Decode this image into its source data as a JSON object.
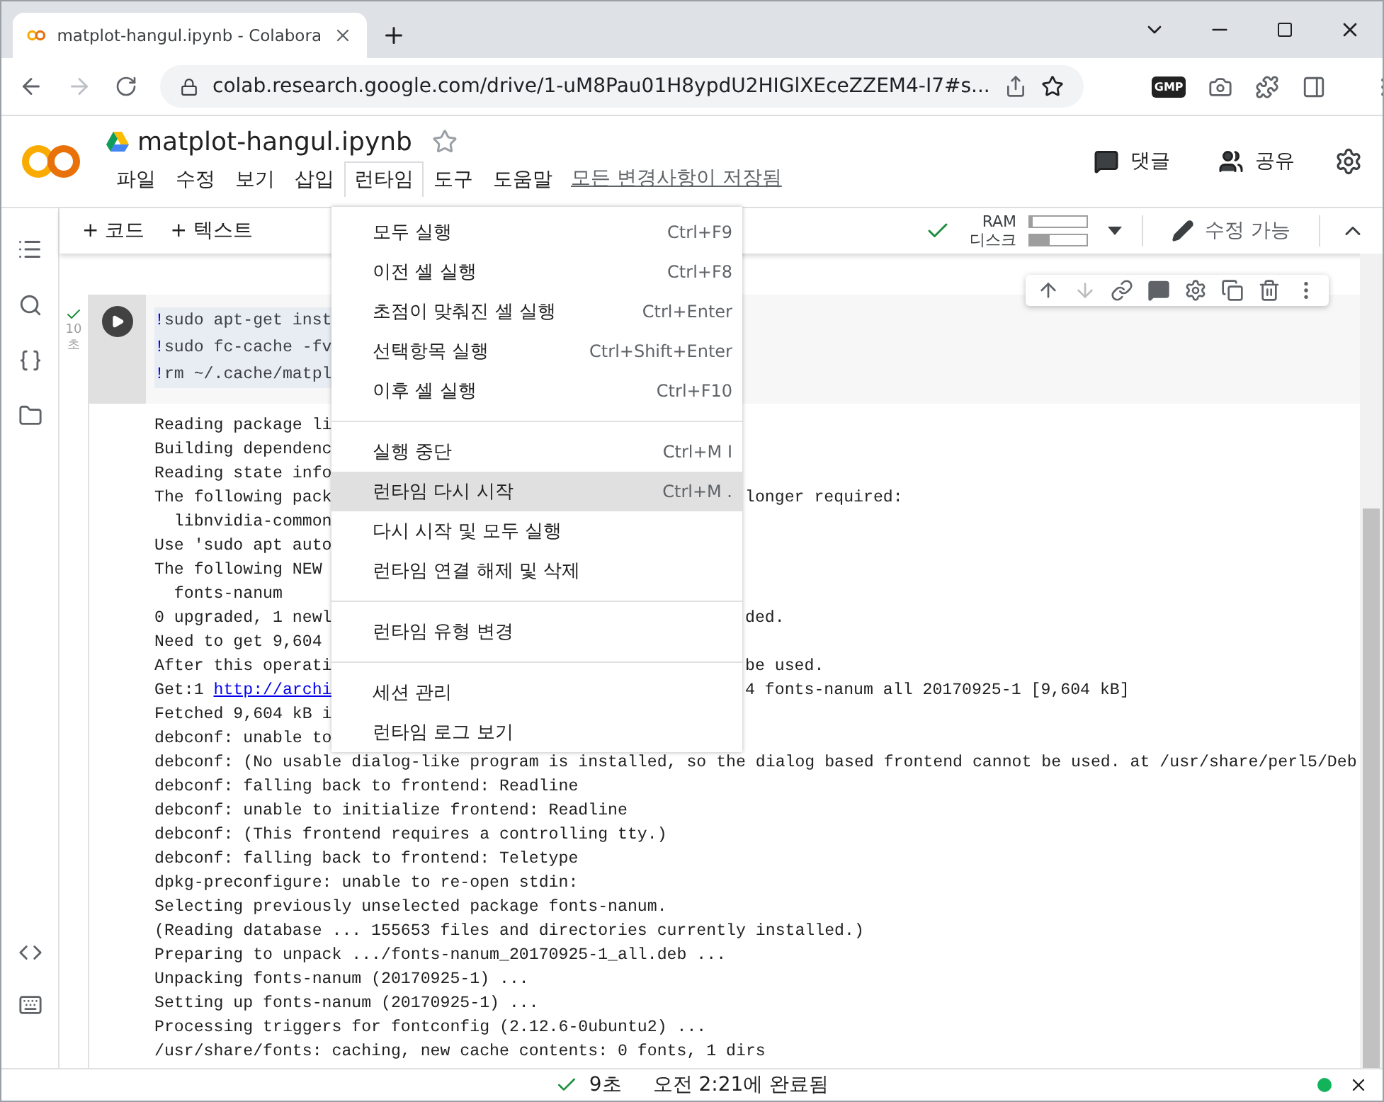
{
  "browser": {
    "tab_title": "matplot-hangul.ipynb - Colabora",
    "url": "colab.research.google.com/drive/1-uM8Pau01H8ypdU2HIGlXEceZZEM4-I7#s...",
    "extension_label": "GMP"
  },
  "notebook": {
    "title": "matplot-hangul.ipynb",
    "starred": false,
    "menu": [
      {
        "label": "파일",
        "selected": false
      },
      {
        "label": "수정",
        "selected": false
      },
      {
        "label": "보기",
        "selected": false
      },
      {
        "label": "삽입",
        "selected": false
      },
      {
        "label": "런타임",
        "selected": true
      },
      {
        "label": "도구",
        "selected": false
      },
      {
        "label": "도움말",
        "selected": false
      }
    ],
    "save_status": "모든 변경사항이 저장됨",
    "comment": "댓글",
    "share": "공유"
  },
  "toolbar": {
    "add_code": "+ 코드",
    "add_text": "+ 텍스트",
    "ram_label": "RAM",
    "disk_label": "디스크",
    "ram": {
      "level": 0.05
    },
    "disk": {
      "level": 0.35
    },
    "edit_mode": "수정 가능"
  },
  "cell": {
    "exec_time": [
      "10",
      "초"
    ],
    "code": [
      "!sudo apt-get inst",
      "!sudo fc-cache -fv",
      "!rm ~/.cache/matpl"
    ],
    "output": [
      {
        "text": "Reading package li"
      },
      {
        "text": "Building dependenc"
      },
      {
        "text": "Reading state info"
      },
      {
        "text": "The following pack",
        "tail": "longer required:"
      },
      {
        "text": "  libnvidia-common"
      },
      {
        "text": "Use 'sudo apt auto"
      },
      {
        "text": "The following NEW"
      },
      {
        "text": "  fonts-nanum"
      },
      {
        "text": "0 upgraded, 1 newl",
        "tail": "ded."
      },
      {
        "text": "Need to get 9,604"
      },
      {
        "text": "After this operati",
        "tail": "be used."
      },
      {
        "text": "Get:1 ",
        "link": "http://archi",
        "tail": "4 fonts-nanum all 20170925-1 [9,604 kB]"
      },
      {
        "text": "Fetched 9,604 kB i"
      },
      {
        "text": "debconf: unable to"
      },
      {
        "text": "debconf: (No usable dialog-like program is installed, so the dialog based frontend cannot be used. at /usr/share/perl5/Deb"
      },
      {
        "text": "debconf: falling back to frontend: Readline"
      },
      {
        "text": "debconf: unable to initialize frontend: Readline"
      },
      {
        "text": "debconf: (This frontend requires a controlling tty.)"
      },
      {
        "text": "debconf: falling back to frontend: Teletype"
      },
      {
        "text": "dpkg-preconfigure: unable to re-open stdin:"
      },
      {
        "text": "Selecting previously unselected package fonts-nanum."
      },
      {
        "text": "(Reading database ... 155653 files and directories currently installed.)"
      },
      {
        "text": "Preparing to unpack .../fonts-nanum_20170925-1_all.deb ..."
      },
      {
        "text": "Unpacking fonts-nanum (20170925-1) ..."
      },
      {
        "text": "Setting up fonts-nanum (20170925-1) ..."
      },
      {
        "text": "Processing triggers for fontconfig (2.12.6-0ubuntu2) ..."
      },
      {
        "text": "/usr/share/fonts: caching, new cache contents: 0 fonts, 1 dirs"
      }
    ]
  },
  "runtime_menu": [
    [
      {
        "label": "모두 실행",
        "shortcut": "Ctrl+F9",
        "highlighted": false
      },
      {
        "label": "이전 셀 실행",
        "shortcut": "Ctrl+F8",
        "highlighted": false
      },
      {
        "label": "초점이 맞춰진 셀 실행",
        "shortcut": "Ctrl+Enter",
        "highlighted": false
      },
      {
        "label": "선택항목 실행",
        "shortcut": "Ctrl+Shift+Enter",
        "highlighted": false
      },
      {
        "label": "이후 셀 실행",
        "shortcut": "Ctrl+F10",
        "highlighted": false
      }
    ],
    [
      {
        "label": "실행 중단",
        "shortcut": "Ctrl+M I",
        "highlighted": false
      },
      {
        "label": "런타임 다시 시작",
        "shortcut": "Ctrl+M .",
        "highlighted": true
      },
      {
        "label": "다시 시작 및 모두 실행",
        "highlighted": false
      },
      {
        "label": "런타임 연결 해제 및 삭제",
        "highlighted": false
      }
    ],
    [
      {
        "label": "런타임 유형 변경",
        "highlighted": false
      }
    ],
    [
      {
        "label": "세션 관리",
        "highlighted": false
      },
      {
        "label": "런타임 로그 보기",
        "highlighted": false
      }
    ]
  ],
  "status_bar": {
    "duration": "9초",
    "completed": "오전 2:21에 완료됨"
  }
}
